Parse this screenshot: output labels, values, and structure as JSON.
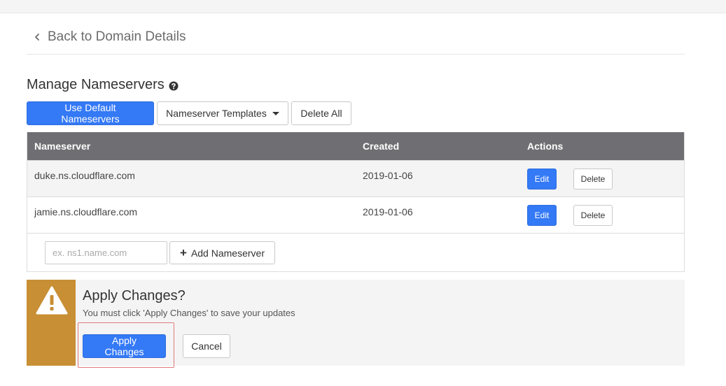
{
  "back_link": {
    "label": "Back to Domain Details"
  },
  "section": {
    "title": "Manage Nameservers"
  },
  "toolbar": {
    "use_default_label": "Use Default Nameservers",
    "templates_label": "Nameserver Templates",
    "delete_all_label": "Delete All"
  },
  "table": {
    "columns": [
      "Nameserver",
      "Created",
      "Actions"
    ],
    "rows": [
      {
        "nameserver": "duke.ns.cloudflare.com",
        "created": "2019-01-06",
        "edit_label": "Edit",
        "delete_label": "Delete"
      },
      {
        "nameserver": "jamie.ns.cloudflare.com",
        "created": "2019-01-06",
        "edit_label": "Edit",
        "delete_label": "Delete"
      }
    ]
  },
  "add_nameserver": {
    "placeholder": "ex. ns1.name.com",
    "value": "",
    "button_label": "Add Nameserver"
  },
  "alert": {
    "title": "Apply Changes?",
    "message": "You must click 'Apply Changes' to save your updates",
    "apply_label": "Apply Changes",
    "cancel_label": "Cancel"
  },
  "icons": {
    "back": "chevron-left-icon",
    "help": "question-circle-icon",
    "dropdown": "caret-down-icon",
    "add": "plus-icon",
    "warning": "warning-triangle-icon"
  },
  "colors": {
    "primary": "#3479f5",
    "table_header": "#6f6f73",
    "alert_stripe": "#c88f35",
    "highlight_border": "#e37b7b"
  }
}
